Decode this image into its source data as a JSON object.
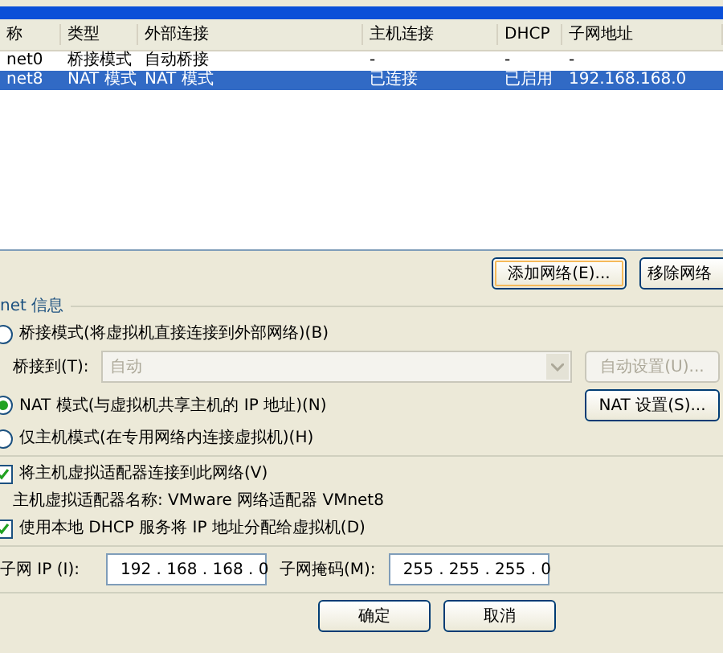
{
  "table": {
    "columns": [
      "称",
      "类型",
      "外部连接",
      "主机连接",
      "DHCP",
      "子网地址"
    ],
    "rows": [
      {
        "cells": [
          "net0",
          "桥接模式",
          "自动桥接",
          "-",
          "-",
          "-"
        ],
        "selected": false
      },
      {
        "cells": [
          "net8",
          "NAT 模式",
          "NAT 模式",
          "已连接",
          "已启用",
          "192.168.168.0"
        ],
        "selected": true
      }
    ]
  },
  "network_buttons": [
    {
      "label": "添加网络(E)...",
      "focused": true
    },
    {
      "label": "移除网络",
      "focused": false
    }
  ],
  "group_title": "net 信息",
  "bridge": {
    "label": "桥接模式(将虚拟机直接连接到外部网络)(B)",
    "selected": false,
    "bridge_to_label": "桥接到(T):",
    "bridge_to_value": "自动",
    "auto_button": "自动设置(U)..."
  },
  "nat": {
    "label": "NAT 模式(与虚拟机共享主机的 IP 地址)(N)",
    "selected": true,
    "settings_button": "NAT 设置(S)..."
  },
  "host_only": {
    "label": "仅主机模式(在专用网络内连接虚拟机)(H)",
    "selected": false
  },
  "connect_adapter": {
    "label": "将主机虚拟适配器连接到此网络(V)",
    "checked": true,
    "adapter_name": "主机虚拟适配器名称: VMware 网络适配器 VMnet8"
  },
  "dhcp": {
    "label": "使用本地 DHCP 服务将 IP 地址分配给虚拟机(D)",
    "checked": true
  },
  "subnet": {
    "ip_label": "子网 IP (I):",
    "ip_value": "192 . 168 . 168 . 0",
    "mask_label": "子网掩码(M):",
    "mask_value": "255 . 255 . 255 . 0"
  },
  "bottom_buttons": [
    "确定",
    "取消"
  ]
}
